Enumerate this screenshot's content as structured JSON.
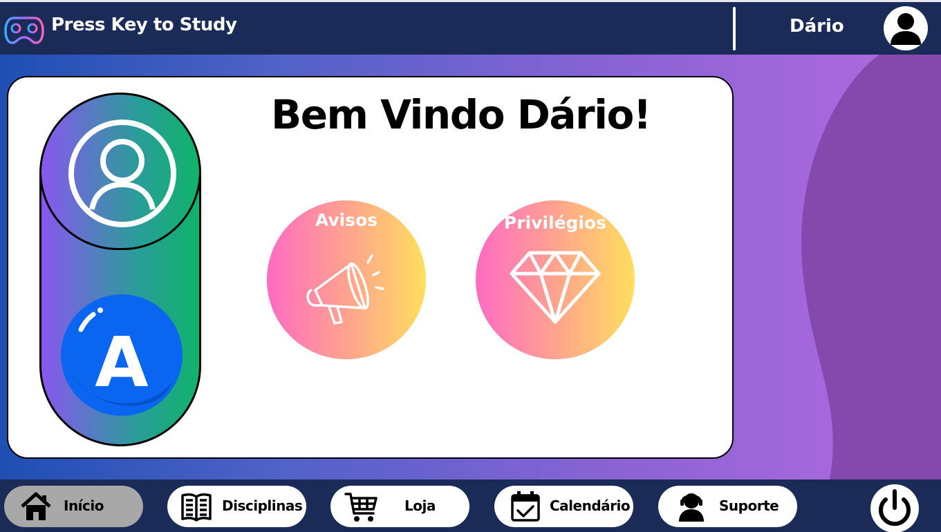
{
  "header": {
    "app_title": "Press Key to Study",
    "user_name": "Dário",
    "logo_icon": "gamepad-icon",
    "avatar_icon": "user-silhouette-icon"
  },
  "main": {
    "welcome": "Bem Vindo Dário!",
    "profile_icon": "user-circle-icon",
    "badge_letter": "A",
    "features": [
      {
        "label": "Avisos",
        "icon": "megaphone-icon"
      },
      {
        "label": "Privilégios",
        "icon": "diamond-icon"
      }
    ]
  },
  "nav": {
    "items": [
      {
        "label": "Início",
        "icon": "home-icon",
        "active": true
      },
      {
        "label": "Disciplinas",
        "icon": "book-icon",
        "active": false
      },
      {
        "label": "Loja",
        "icon": "cart-icon",
        "active": false
      },
      {
        "label": "Calendário",
        "icon": "calendar-icon",
        "active": false
      },
      {
        "label": "Suporte",
        "icon": "support-headset-icon",
        "active": false
      }
    ],
    "power_icon": "power-icon"
  },
  "colors": {
    "header_bg": "#1b2b57",
    "accent_pink": "#ff6bc2",
    "accent_yellow": "#ffdf5e",
    "badge_blue": "#0a66f0",
    "pill_green": "#0fb36a",
    "pill_purple": "#8a56f0"
  }
}
